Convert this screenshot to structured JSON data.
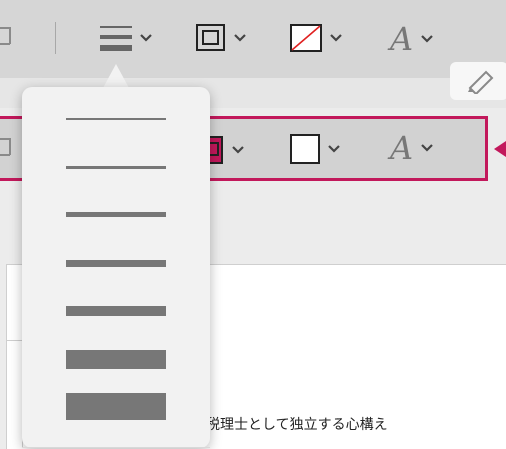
{
  "toolbar": {
    "tools": [
      {
        "id": "line-weight",
        "icon": "line-weight-icon"
      },
      {
        "id": "border-color",
        "icon": "border-color-icon"
      },
      {
        "id": "fill-color",
        "icon": "no-fill-icon"
      },
      {
        "id": "text-style",
        "icon": "font-icon",
        "glyph": "A"
      }
    ]
  },
  "highlighted_toolbar": {
    "tools": [
      {
        "id": "border-color",
        "icon": "border-color-icon",
        "color": "#c2185b"
      },
      {
        "id": "fill-color",
        "icon": "fill-white-icon",
        "color": "#ffffff"
      },
      {
        "id": "text-style",
        "icon": "font-icon",
        "glyph": "A"
      }
    ],
    "highlight_color": "#c2185b"
  },
  "line_weight_popover": {
    "options": [
      {
        "weight": "1pt"
      },
      {
        "weight": "2pt"
      },
      {
        "weight": "3pt"
      },
      {
        "weight": "5pt"
      },
      {
        "weight": "8pt"
      },
      {
        "weight": "12pt"
      },
      {
        "weight": "16pt"
      }
    ]
  },
  "document": {
    "heading_fragment": "税理士として独立する心構え"
  },
  "colors": {
    "accent": "#c2185b",
    "icon": "#666666",
    "fill_slash": "#e02020"
  }
}
